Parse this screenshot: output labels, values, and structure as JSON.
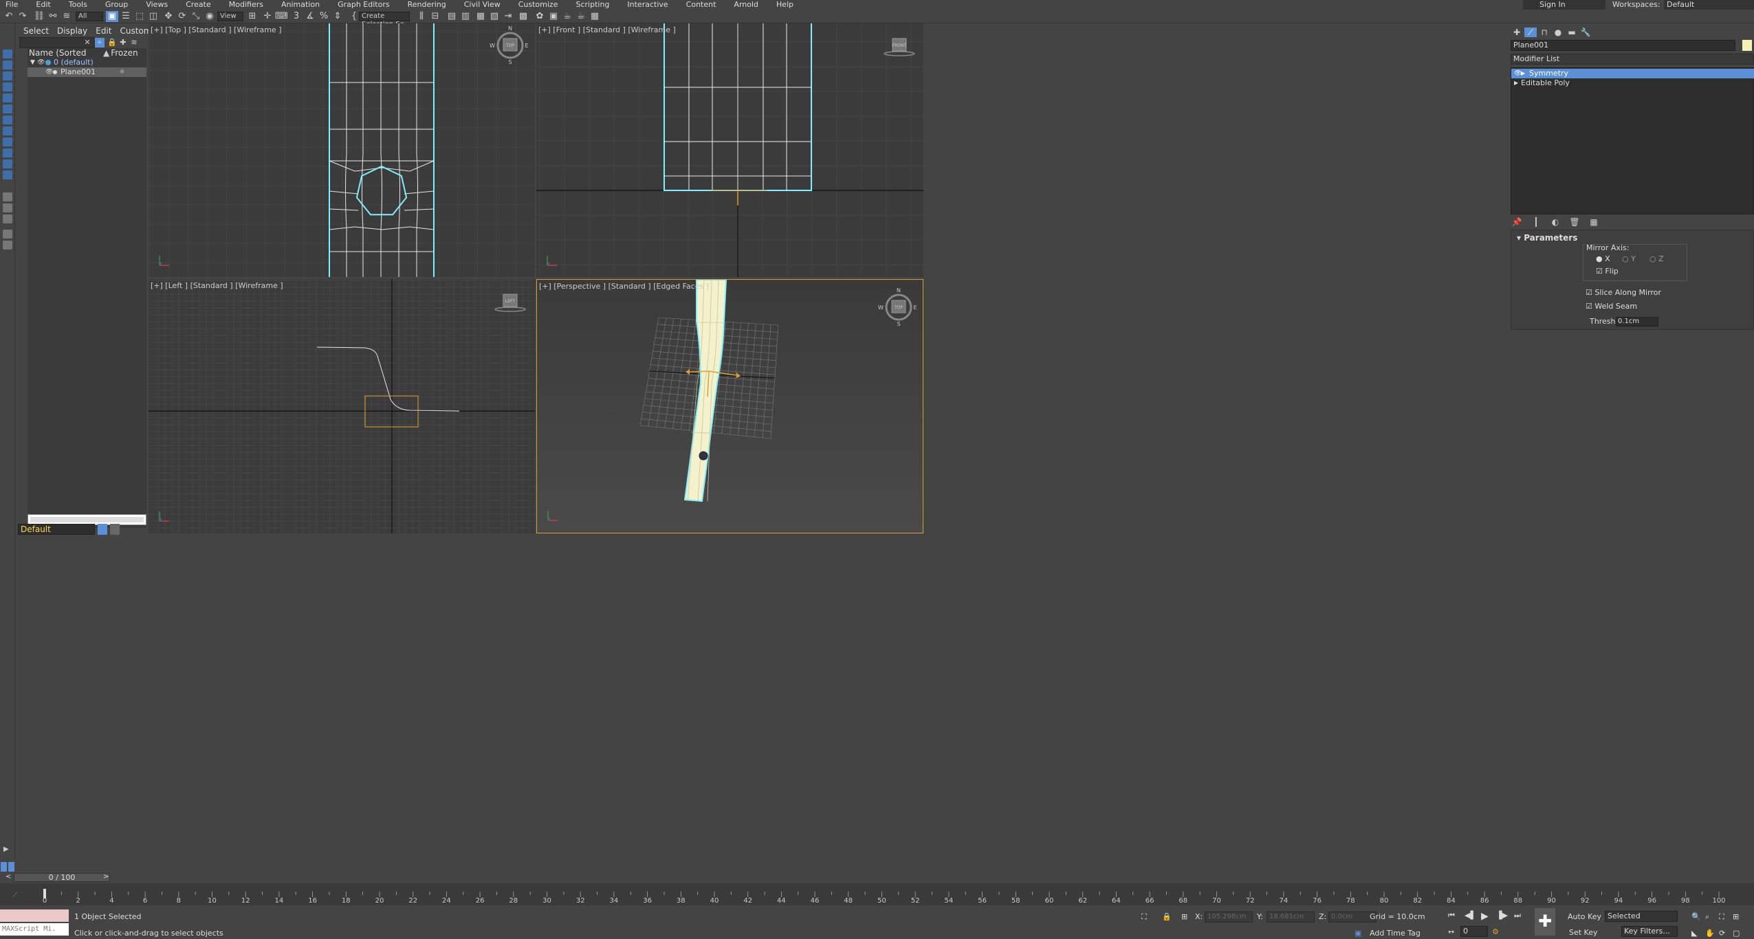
{
  "menu": [
    "File",
    "Edit",
    "Tools",
    "Group",
    "Views",
    "Create",
    "Modifiers",
    "Animation",
    "Graph Editors",
    "Rendering",
    "Civil View",
    "Customize",
    "Scripting",
    "Interactive",
    "Content",
    "Arnold",
    "Help"
  ],
  "account": {
    "signin": "Sign In",
    "workspaces_label": "Workspaces:",
    "workspace": "Default"
  },
  "toolbar": {
    "filter": "All",
    "ref_coord": "View",
    "selection_set": "Create Selection Se"
  },
  "explorer": {
    "tabs": [
      "Select",
      "Display",
      "Edit",
      "Customize"
    ],
    "col_name": "Name (Sorted Ascendi...",
    "col_frozen": "Frozen",
    "rows": [
      "0 (default)",
      "Plane001"
    ],
    "layer": "Default"
  },
  "viewports": {
    "top": "[+] [Top ] [Standard ] [Wireframe ]",
    "front": "[+] [Front ] [Standard ] [Wireframe ]",
    "left": "[+] [Left ] [Standard ] [Wireframe ]",
    "persp": "[+] [Perspective ] [Standard ] [Edged Faces ]"
  },
  "viewcube": {
    "top": "TOP",
    "front": "FRONT",
    "left": "LEFT",
    "n": "N",
    "s": "S",
    "e": "E",
    "w": "W"
  },
  "command_panel": {
    "object_name": "Plane001",
    "modifier_list": "Modifier List",
    "stack": [
      "Symmetry",
      "Editable Poly"
    ],
    "params_title": "Parameters",
    "mirror_axis": "Mirror Axis:",
    "axes": [
      "X",
      "Y",
      "Z"
    ],
    "flip": "Flip",
    "slice": "Slice Along Mirror",
    "weld": "Weld Seam",
    "threshold_label": "Threshold:",
    "threshold": "0.1cm"
  },
  "timeline": {
    "frame": "0 / 100",
    "ticks": [
      0,
      2,
      4,
      6,
      8,
      10,
      12,
      14,
      16,
      18,
      20,
      22,
      24,
      26,
      28,
      30,
      32,
      34,
      36,
      38,
      40,
      42,
      44,
      46,
      48,
      50,
      52,
      54,
      56,
      58,
      60,
      62,
      64,
      66,
      68,
      70,
      72,
      74,
      76,
      78,
      80,
      82,
      84,
      86,
      88,
      90,
      92,
      94,
      96,
      98,
      100
    ]
  },
  "status": {
    "maxscript": "MAXScript Mi.",
    "selected": "1 Object Selected",
    "prompt": "Click or click-and-drag to select objects",
    "x_label": "X:",
    "x": "105.298cm",
    "y_label": "Y:",
    "y": "18.681cm",
    "z_label": "Z:",
    "z": "0.0cm",
    "grid": "Grid = 10.0cm",
    "add_time_tag": "Add Time Tag",
    "auto_key": "Auto Key",
    "set_key": "Set Key",
    "key_mode": "Selected",
    "key_filters": "Key Filters...",
    "frame_field": "0"
  },
  "colors": {
    "accent": "#5b8fd6",
    "wire": "#7ff0ff",
    "selection": "#e0a030"
  }
}
